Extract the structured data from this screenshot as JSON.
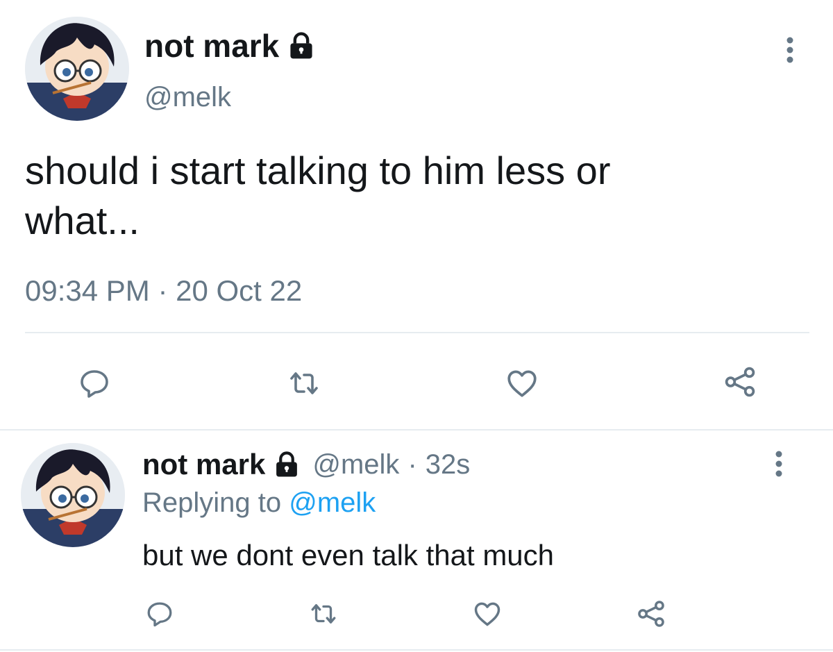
{
  "main_tweet": {
    "display_name": "not mark",
    "handle": "@melk",
    "text_line1": "should i start talking to him less or",
    "text_line2": "what...",
    "timestamp": "09:34 PM · 20 Oct 22",
    "icons": {
      "protected": "lock-icon",
      "more": "more-vertical-icon",
      "reply": "reply-icon",
      "retweet": "retweet-icon",
      "like": "heart-icon",
      "share": "share-icon"
    }
  },
  "reply_tweet": {
    "display_name": "not mark",
    "handle": "@melk",
    "separator": "·",
    "age": "32s",
    "replying_prefix": "Replying to",
    "replying_handle": "@melk",
    "text": "but we dont even talk that much"
  },
  "colors": {
    "text": "#14171a",
    "secondary": "#657786",
    "accent": "#1da1f2",
    "divider": "#e6ecf0"
  }
}
